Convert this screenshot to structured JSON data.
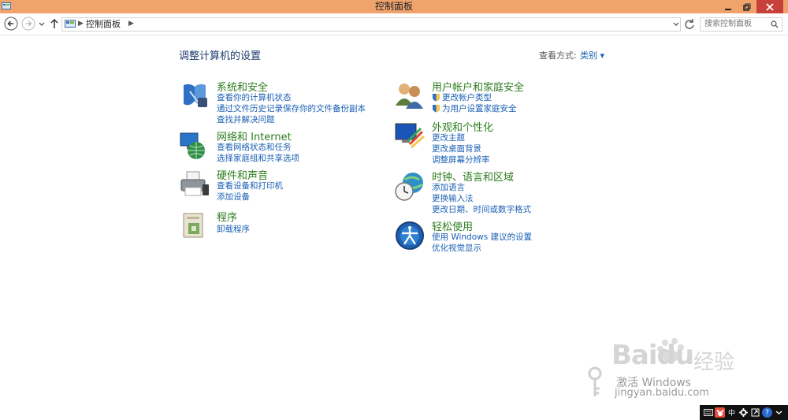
{
  "window": {
    "title": "控制面板"
  },
  "address": {
    "crumb": "控制面板",
    "search_placeholder": "搜索控制面板"
  },
  "main": {
    "title": "调整计算机的设置",
    "view_label": "查看方式:",
    "view_value": "类别 ▾"
  },
  "categories": [
    {
      "title": "系统和安全",
      "links": [
        "查看你的计算机状态",
        "通过文件历史记录保存你的文件备份副本",
        "查找并解决问题"
      ]
    },
    {
      "title": "网络和 Internet",
      "links": [
        "查看网络状态和任务",
        "选择家庭组和共享选项"
      ]
    },
    {
      "title": "硬件和声音",
      "links": [
        "查看设备和打印机",
        "添加设备"
      ]
    },
    {
      "title": "程序",
      "links": [
        "卸载程序"
      ]
    },
    {
      "title": "用户帐户和家庭安全",
      "links": [
        "更改帐户类型",
        "为用户设置家庭安全"
      ]
    },
    {
      "title": "外观和个性化",
      "links": [
        "更改主题",
        "更改桌面背景",
        "调整屏幕分辨率"
      ]
    },
    {
      "title": "时钟、语言和区域",
      "links": [
        "添加语言",
        "更换输入法",
        "更改日期、时间或数字格式"
      ]
    },
    {
      "title": "轻松使用",
      "links": [
        "使用 Windows 建议的设置",
        "优化视觉显示"
      ]
    }
  ],
  "watermark": {
    "brand": "Baidu",
    "cn": "经验",
    "activate_line1": "激活 Windows",
    "activate_line2": "jingyan.baidu.com"
  },
  "tray": {
    "ime": "中"
  },
  "colors": {
    "titlebar": "#f0a36d",
    "close": "#c7403a",
    "category_title": "#2d7d1e",
    "link": "#1a5fb4"
  }
}
